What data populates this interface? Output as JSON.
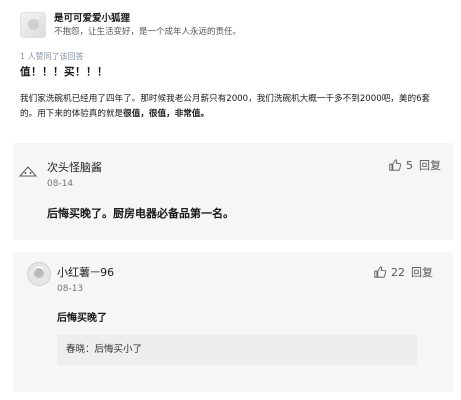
{
  "answer": {
    "author_name": "是可可爱爱小狐狸",
    "author_bio": "不抱怨，让生活变好，是一个成年人永远的责任。",
    "vote_info": "1 人赞同了该回答",
    "title": "值！！！买！！！",
    "body_plain": "我们家洗碗机已经用了四年了。那时候我老公月薪只有2000，我们洗碗机大概一千多不到2000吧，美的6套的。用下来的体验真的就是",
    "body_strong": "很值，很值，非常值。"
  },
  "comments": [
    {
      "author": "次头怪脑酱",
      "date": "08-14",
      "likes": "5",
      "reply_label": "回复",
      "text": "后悔买晚了。厨房电器必备品第一名。"
    },
    {
      "author": "小红薯ㅡ96",
      "date": "08-13",
      "likes": "22",
      "reply_label": "回复",
      "text": "后悔买晚了",
      "sub_reply": "春晓：后悔买小了"
    }
  ],
  "icons": {
    "like": "thumbs-up-icon",
    "colors": {
      "icon_gray": "#666666",
      "card_bg": "#f6f6f6",
      "reply_bg": "#eeeeee"
    }
  }
}
